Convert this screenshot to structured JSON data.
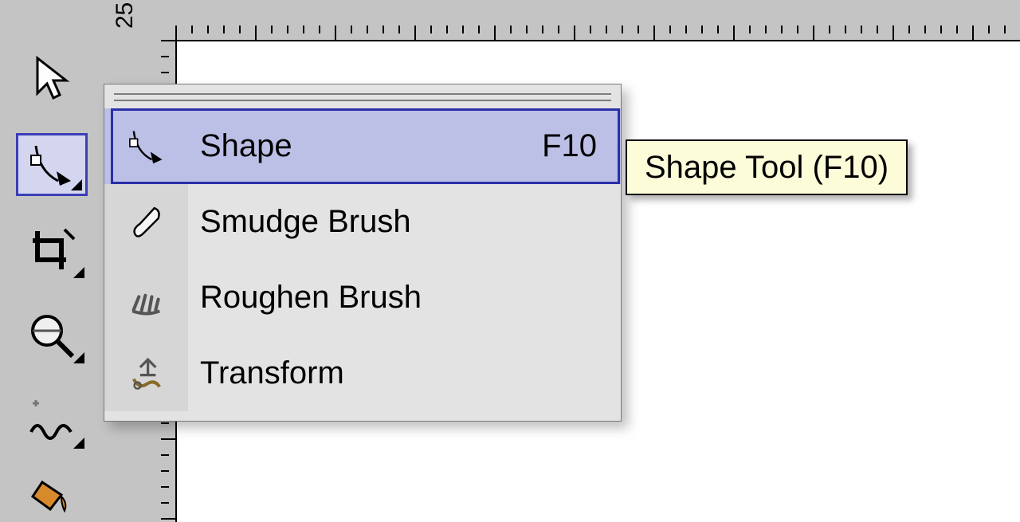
{
  "ruler": {
    "tick25": "25"
  },
  "toolbox": {
    "pick_tool": "Pick",
    "shape_tool": "Shape",
    "crop_tool": "Crop",
    "zoom_tool": "Zoom",
    "freehand_tool": "Freehand",
    "fill_tool": "Smart Fill"
  },
  "flyout": {
    "items": [
      {
        "label": "Shape",
        "shortcut": "F10"
      },
      {
        "label": "Smudge Brush",
        "shortcut": ""
      },
      {
        "label": "Roughen Brush",
        "shortcut": ""
      },
      {
        "label": "Transform",
        "shortcut": ""
      }
    ]
  },
  "tooltip": {
    "text": "Shape Tool (F10)"
  }
}
